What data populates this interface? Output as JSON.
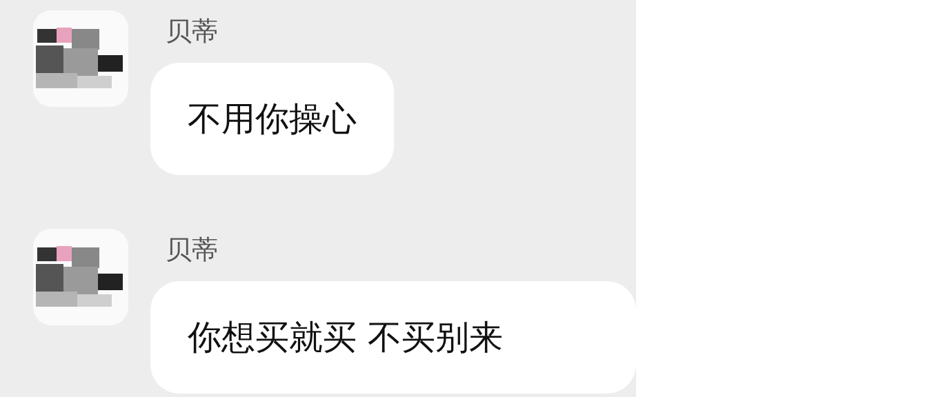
{
  "messages": [
    {
      "sender": "贝蒂",
      "text": "不用你操心"
    },
    {
      "sender": "贝蒂",
      "text": "你想买就买 不买别来"
    }
  ]
}
